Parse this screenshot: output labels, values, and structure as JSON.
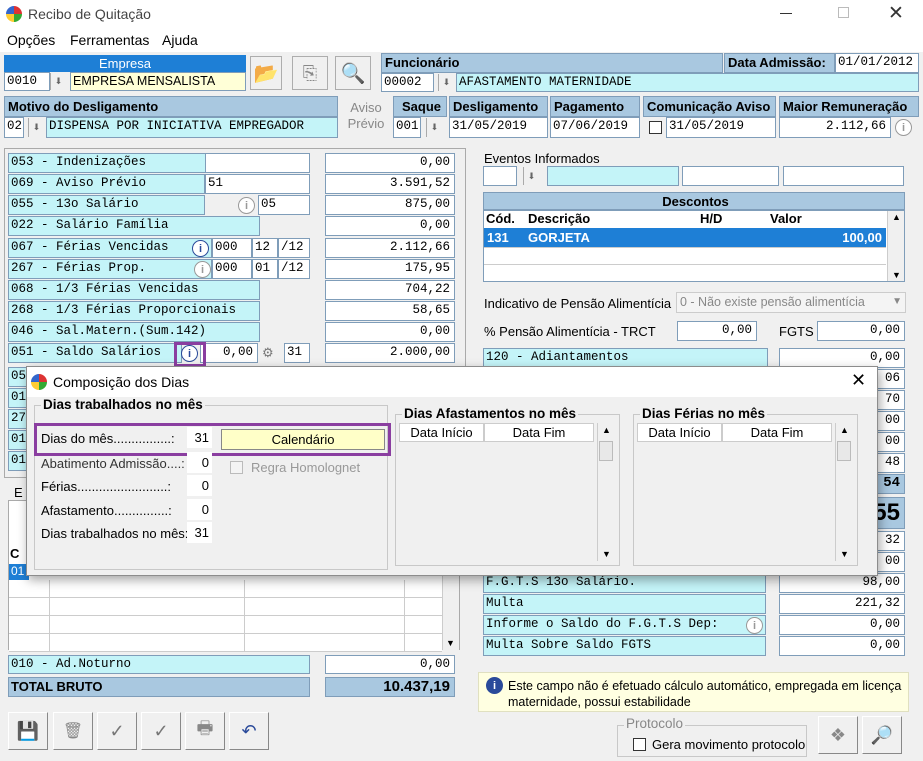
{
  "window": {
    "title": "Recibo de Quitação"
  },
  "menu": [
    "Opções",
    "Ferramentas",
    "Ajuda"
  ],
  "empresa": {
    "label": "Empresa",
    "code": "0010",
    "name": "EMPRESA MENSALISTA"
  },
  "funcionario": {
    "label": "Funcionário",
    "code": "00002",
    "name": "AFASTAMENTO MATERNIDADE"
  },
  "admissao": {
    "label": "Data Admissão:",
    "value": "01/01/2012"
  },
  "motivo": {
    "label": "Motivo do Desligamento",
    "code": "02",
    "value": "DISPENSA POR INICIATIVA EMPREGADOR"
  },
  "aviso_previo": {
    "line1": "Aviso",
    "line2": "Prévio"
  },
  "saque": {
    "label": "Saque",
    "value": "001"
  },
  "desligamento": {
    "label": "Desligamento",
    "value": "31/05/2019"
  },
  "pagamento": {
    "label": "Pagamento",
    "value": "07/06/2019"
  },
  "comunicacao": {
    "label": "Comunicação Aviso",
    "value": "31/05/2019"
  },
  "maior_rem": {
    "label": "Maior Remuneração",
    "value": "2.112,66"
  },
  "verbas": [
    {
      "desc": "053 - Indenizações",
      "ref": "",
      "value": "0,00"
    },
    {
      "desc": "069 - Aviso Prévio",
      "ref": "51",
      "value": "3.591,52"
    },
    {
      "desc": "055 - 13o Salário",
      "ref": "05",
      "value": "875,00"
    },
    {
      "desc": "022 - Salário Família",
      "ref": "",
      "value": "0,00"
    },
    {
      "desc": "067 - Férias Vencidas",
      "ref": "000",
      "r2": "12",
      "r3": "/12",
      "value": "2.112,66"
    },
    {
      "desc": "267 - Férias Prop.",
      "ref": "000",
      "r2": "01",
      "r3": "/12",
      "value": "175,95"
    },
    {
      "desc": "068 - 1/3 Férias Vencidas",
      "ref": "",
      "value": "704,22"
    },
    {
      "desc": "268 - 1/3 Férias Proporcionais",
      "ref": "",
      "value": "58,65"
    },
    {
      "desc": "046 - Sal.Matern.(Sum.142)",
      "ref": "",
      "value": "0,00"
    },
    {
      "desc": "051 - Saldo Salários",
      "ref": "0,00",
      "r2": "31",
      "value": "2.000,00"
    }
  ],
  "eventos": {
    "label": "Eventos Informados"
  },
  "descontos": {
    "title": "Descontos",
    "cols": [
      "Cód.",
      "Descrição",
      "H/D",
      "Valor"
    ],
    "rows": [
      {
        "cod": "131",
        "desc": "GORJETA",
        "hd": "",
        "valor": "100,00"
      }
    ]
  },
  "pensao": {
    "label": "Indicativo de Pensão Alimentícia",
    "value": "0 - Não existe pensão alimentícia",
    "pct_label": "% Pensão Alimentícia - TRCT",
    "pct_value": "0,00",
    "fgts_label": "FGTS",
    "fgts_value": "0,00"
  },
  "right_rows": [
    {
      "desc": "120 - Adiantamentos",
      "value": "0,00"
    },
    {
      "desc": "",
      "value": "06"
    },
    {
      "desc": "",
      "value": "70"
    },
    {
      "desc": "",
      "value": "00"
    },
    {
      "desc": "",
      "value": "00"
    },
    {
      "desc": "",
      "value": "48"
    },
    {
      "desc": "",
      "value": "54"
    }
  ],
  "right_big": "55",
  "right_lower": [
    {
      "desc": "",
      "value": "32"
    },
    {
      "desc": "",
      "value": "00"
    },
    {
      "desc": "F.G.T.S 13o Salário.",
      "value": "98,00"
    },
    {
      "desc": "Multa",
      "value": "221,32"
    },
    {
      "desc": "Informe o Saldo do F.G.T.S Dep:",
      "value": "0,00"
    },
    {
      "desc": "Multa Sobre Saldo FGTS",
      "value": "0,00"
    }
  ],
  "ad_noturno": {
    "desc": "010 - Ad.Noturno",
    "value": "0,00"
  },
  "total_bruto": {
    "label": "TOTAL BRUTO",
    "value": "10.437,19"
  },
  "info_msg": "Este campo não é efetuado cálculo automático, empregada em licença maternidade, possui estabilidade",
  "protocolo": {
    "title": "Protocolo",
    "check_label": "Gera movimento protocolo"
  },
  "left_lower": {
    "e_label": "E",
    "c_label": "C",
    "o_label": "01"
  },
  "dialog": {
    "title": "Composição dos Dias",
    "group1": "Dias trabalhados no mês",
    "dias_mes_label": "Dias do mês................:",
    "dias_mes": "31",
    "calendario": "Calendário",
    "abat_label": "Abatimento Admissão....:",
    "abat": "0",
    "regra": "Regra Homolognet",
    "ferias_label": "Férias.........................:",
    "ferias": "0",
    "afast_label": "Afastamento...............:",
    "afast": "0",
    "trab_label": "Dias trabalhados no mês:",
    "trab": "31",
    "group2": "Dias Afastamentos no mês",
    "group3": "Dias Férias no mês",
    "col_inicio": "Data Início",
    "col_fim": "Data Fim"
  },
  "left_partial": [
    "05",
    "01",
    "27",
    "01",
    "01"
  ]
}
